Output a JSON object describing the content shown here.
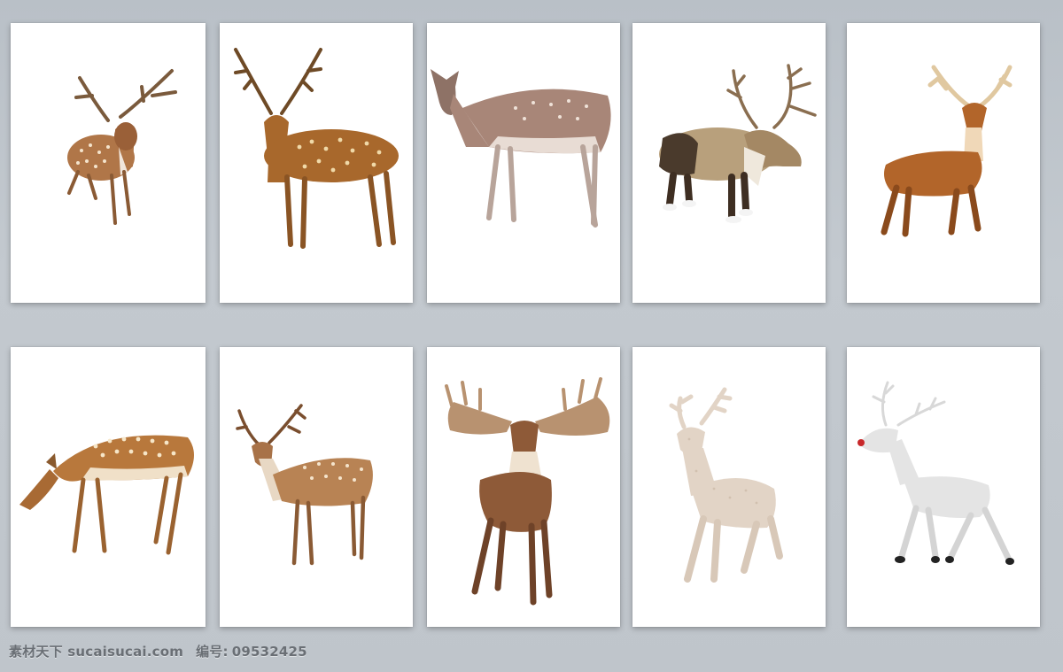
{
  "watermark": {
    "site": "素材天下 sucaisucai.com",
    "code_label": "编号:",
    "code_value": "09532425"
  },
  "cards": [
    {
      "icon": "sika-deer-icon",
      "colors": {
        "body": "#b07648",
        "spot": "#f4e4cc",
        "antler": "#7a5a3c"
      }
    },
    {
      "icon": "spotted-deer-icon",
      "colors": {
        "body": "#a8682c",
        "spot": "#f0d9a8",
        "antler": "#6e4a26"
      }
    },
    {
      "icon": "fallow-doe-icon",
      "colors": {
        "body": "#a88678",
        "spot": "#efe2d8",
        "antler": ""
      }
    },
    {
      "icon": "reindeer-icon",
      "colors": {
        "body": "#b8a07c",
        "spot": "",
        "antler": "#8a6e50"
      }
    },
    {
      "icon": "cartoon-stag-icon",
      "colors": {
        "body": "#b2652a",
        "spot": "#f0d8b8",
        "antler": "#e0c8a0"
      }
    },
    {
      "icon": "grazing-fawn-icon",
      "colors": {
        "body": "#b8783c",
        "spot": "#f6e6c8",
        "antler": ""
      }
    },
    {
      "icon": "fallow-buck-icon",
      "colors": {
        "body": "#b88354",
        "spot": "#f4e4cc",
        "antler": "#7a4e2e"
      }
    },
    {
      "icon": "giant-antler-stag-icon",
      "colors": {
        "body": "#8e5a38",
        "spot": "#efe2d0",
        "antler": "#b89270"
      }
    },
    {
      "icon": "glitter-deer-figurine-icon",
      "colors": {
        "body": "#e2d4c6",
        "spot": "#cbb8a6",
        "antler": "#e2d4c6"
      }
    },
    {
      "icon": "white-reindeer-icon",
      "colors": {
        "body": "#e4e4e4",
        "spot": "#c4c4c4",
        "antler": "#d8d8d8"
      }
    }
  ]
}
